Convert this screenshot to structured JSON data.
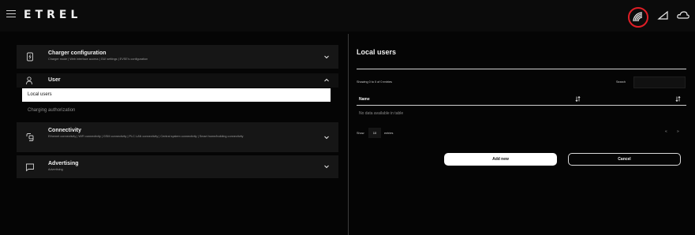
{
  "header": {
    "logo_text": "ETREL",
    "icons": [
      "menu-icon",
      "signal-icon",
      "cellular-icon",
      "cloud-icon"
    ],
    "highlight_color": "#e01e26"
  },
  "sidebar": {
    "charger_configuration": {
      "title": "Charger configuration",
      "subtitle": "Charger mode | Web interface access | GUI settings | EVSE's configuration",
      "icon": "charger-icon"
    },
    "user": {
      "title": "User",
      "icon": "user-icon",
      "expanded": true,
      "items": [
        {
          "label": "Local users",
          "selected": true
        },
        {
          "label": "Charging authorization",
          "selected": false
        }
      ]
    },
    "connectivity": {
      "title": "Connectivity",
      "subtitle": "Ethernet connectivity | WiFi connectivity | GSM connectivity | PLC LAN connectivity | Central system connectivity | Smart home/building connectivity",
      "icon": "connectivity-icon"
    },
    "advertising": {
      "title": "Advertising",
      "subtitle": "Advertising",
      "icon": "advertising-icon"
    }
  },
  "main": {
    "title": "Local users",
    "showing_text": "Showing 0 to 0 of 0 entries",
    "search_label": "Search",
    "search_value": "",
    "table": {
      "columns": [
        "Name"
      ],
      "empty_text": "No data available in table"
    },
    "show_label": "Show",
    "page_size": "10",
    "entries_label": "entries",
    "pager_prev": "«",
    "pager_next": "»",
    "add_button": "Add new",
    "cancel_button": "Cancel"
  }
}
